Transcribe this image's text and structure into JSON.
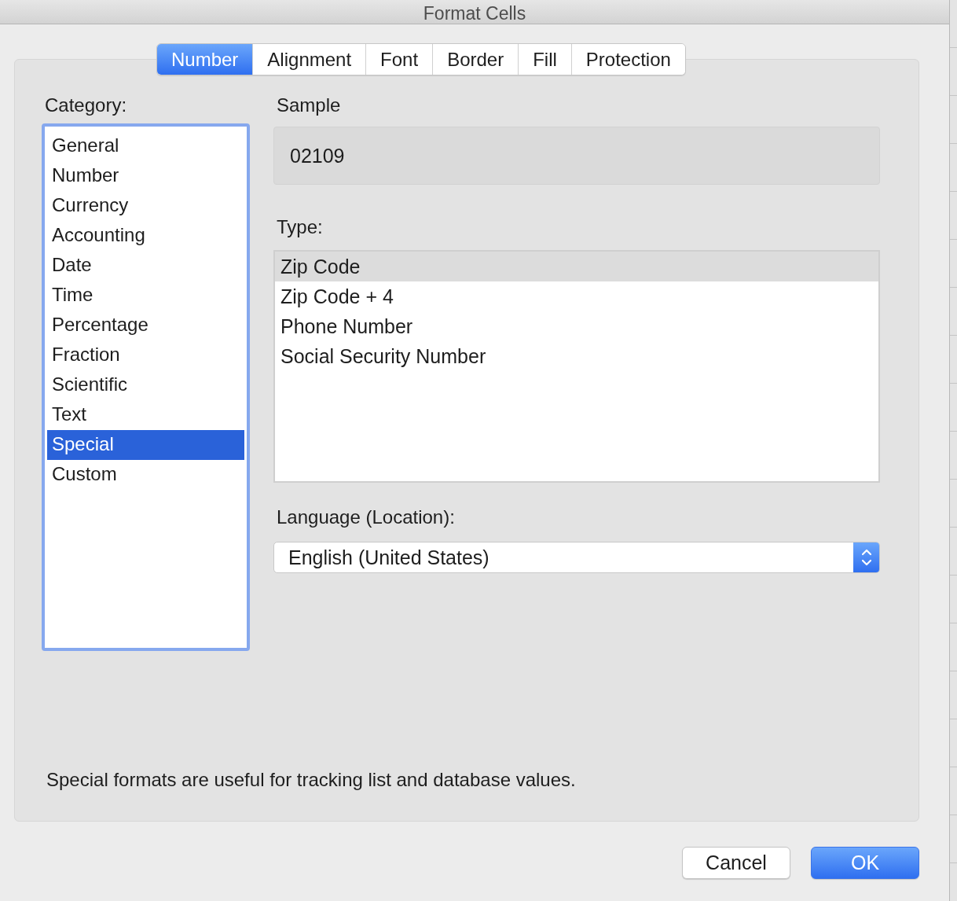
{
  "window": {
    "title": "Format Cells"
  },
  "tabs": [
    {
      "label": "Number",
      "selected": true
    },
    {
      "label": "Alignment",
      "selected": false
    },
    {
      "label": "Font",
      "selected": false
    },
    {
      "label": "Border",
      "selected": false
    },
    {
      "label": "Fill",
      "selected": false
    },
    {
      "label": "Protection",
      "selected": false
    }
  ],
  "category": {
    "label": "Category:",
    "items": [
      {
        "label": "General",
        "selected": false
      },
      {
        "label": "Number",
        "selected": false
      },
      {
        "label": "Currency",
        "selected": false
      },
      {
        "label": "Accounting",
        "selected": false
      },
      {
        "label": "Date",
        "selected": false
      },
      {
        "label": "Time",
        "selected": false
      },
      {
        "label": "Percentage",
        "selected": false
      },
      {
        "label": "Fraction",
        "selected": false
      },
      {
        "label": "Scientific",
        "selected": false
      },
      {
        "label": "Text",
        "selected": false
      },
      {
        "label": "Special",
        "selected": true
      },
      {
        "label": "Custom",
        "selected": false
      }
    ]
  },
  "sample": {
    "label": "Sample",
    "value": "02109"
  },
  "type": {
    "label": "Type:",
    "items": [
      {
        "label": "Zip Code",
        "selected": true
      },
      {
        "label": "Zip Code + 4",
        "selected": false
      },
      {
        "label": "Phone Number",
        "selected": false
      },
      {
        "label": "Social Security Number",
        "selected": false
      }
    ]
  },
  "language": {
    "label": "Language (Location):",
    "value": "English (United States)"
  },
  "description": "Special formats are useful for tracking list and database values.",
  "buttons": [
    {
      "label": "Cancel",
      "kind": "secondary"
    },
    {
      "label": "OK",
      "kind": "primary"
    }
  ]
}
